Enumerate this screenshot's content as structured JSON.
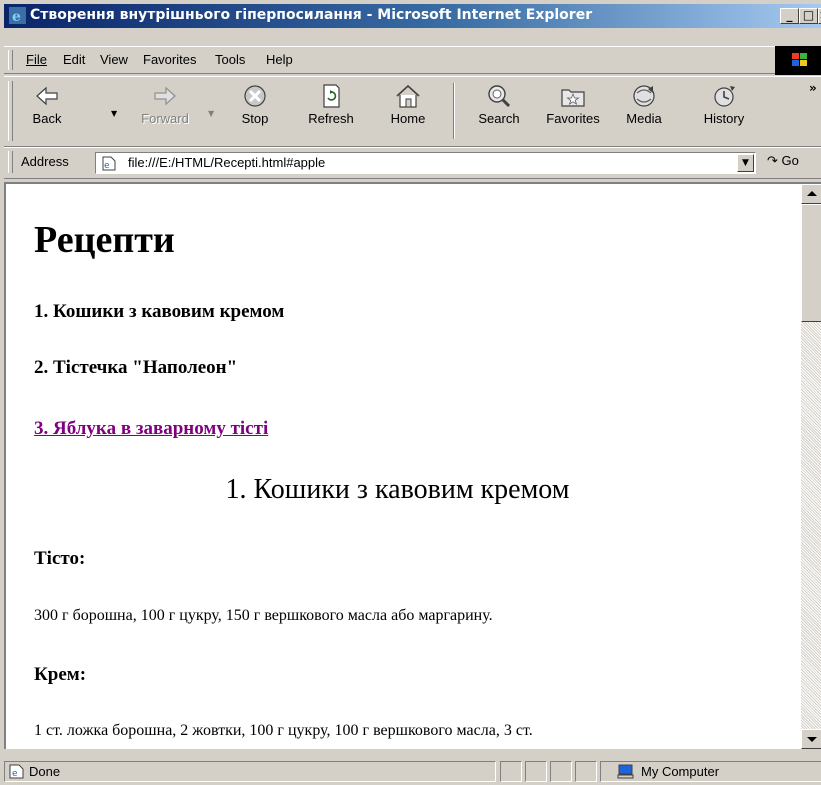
{
  "window": {
    "title": "Створення внутрішнього гіперпосилання - Microsoft Internet Explorer",
    "minimize": "_",
    "maximize": "□",
    "close": "×"
  },
  "menu": {
    "items": [
      {
        "label": "File"
      },
      {
        "label": "Edit"
      },
      {
        "label": "View"
      },
      {
        "label": "Favorites"
      },
      {
        "label": "Tools"
      },
      {
        "label": "Help"
      }
    ]
  },
  "toolbar": {
    "back": "Back",
    "forward": "Forward",
    "stop": "Stop",
    "refresh": "Refresh",
    "home": "Home",
    "search": "Search",
    "favorites": "Favorites",
    "media": "Media",
    "history": "History",
    "more": "»"
  },
  "address": {
    "label": "Address",
    "url": "file:///E:/HTML/Recepti.html#apple",
    "go": "Go"
  },
  "page": {
    "heading": "Рецепти",
    "toc": [
      {
        "text": "1. Кошики з кавовим кремом",
        "visited": false
      },
      {
        "text": "2. Тістечка \"Наполеон\"",
        "visited": false
      },
      {
        "text": "3. Яблука в заварному тісті",
        "visited": true
      }
    ],
    "section1_title": "1. Кошики з кавовим кремом",
    "dough_label": "Тісто:",
    "dough_text": "300 г борошна, 100 г цукру, 150 г вершкового масла або маргарину.",
    "cream_label": "Крем:",
    "cream_text": "1 ст. ложка борошна, 2 жовтки, 100 г цукру, 100 г вершкового масла, 3 ст."
  },
  "status": {
    "text": "Done",
    "zone": "My Computer"
  },
  "colors": {
    "titlebar_start": "#0a246a",
    "titlebar_end": "#a6caf0",
    "visited_link": "#800080",
    "chrome": "#d4d0c8"
  }
}
